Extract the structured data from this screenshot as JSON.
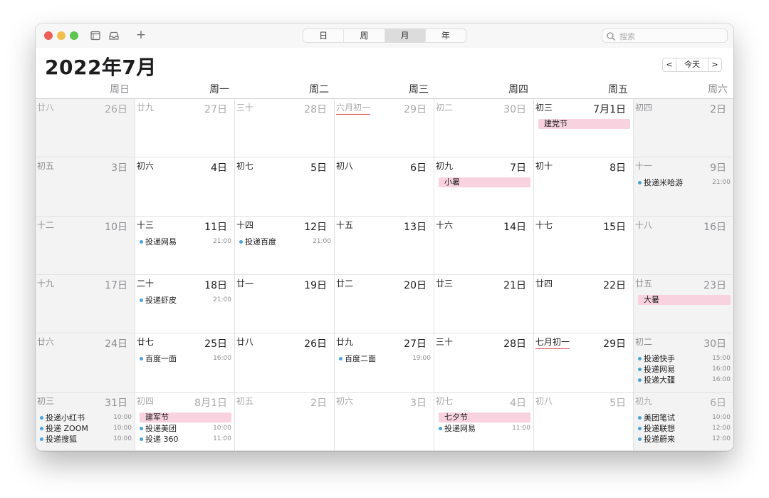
{
  "toolbar": {
    "views": [
      "日",
      "周",
      "月",
      "年"
    ],
    "active_view": "月",
    "search_placeholder": "搜索",
    "add_label": "+"
  },
  "header": {
    "title": "2022年7月",
    "today_label": "今天",
    "prev_label": "<",
    "next_label": ">"
  },
  "weekdays": [
    "周日",
    "周一",
    "周二",
    "周三",
    "周四",
    "周五",
    "周六"
  ],
  "colors": {
    "close": "#ec5f57",
    "minimize": "#f4be4f",
    "zoom": "#5ec64d",
    "allday_event": "#f8d3df",
    "event_dot": "#4aa3df",
    "lunar_underline": "#e0505a"
  },
  "weeks": [
    [
      {
        "day": "26日",
        "lunar": "廿八",
        "dim": true,
        "events": []
      },
      {
        "day": "27日",
        "lunar": "廿九",
        "dim": true,
        "events": []
      },
      {
        "day": "28日",
        "lunar": "三十",
        "dim": true,
        "events": []
      },
      {
        "day": "29日",
        "lunar": "六月初一",
        "dim": true,
        "underline": true,
        "events": []
      },
      {
        "day": "30日",
        "lunar": "初二",
        "dim": true,
        "events": []
      },
      {
        "day": "7月1日",
        "lunar": "初三",
        "events": [
          {
            "type": "allday",
            "name": "建党节"
          }
        ]
      },
      {
        "day": "2日",
        "lunar": "初四",
        "events": []
      }
    ],
    [
      {
        "day": "3日",
        "lunar": "初五",
        "events": []
      },
      {
        "day": "4日",
        "lunar": "初六",
        "events": []
      },
      {
        "day": "5日",
        "lunar": "初七",
        "events": []
      },
      {
        "day": "6日",
        "lunar": "初八",
        "events": []
      },
      {
        "day": "7日",
        "lunar": "初九",
        "events": [
          {
            "type": "allday",
            "name": "小暑"
          }
        ]
      },
      {
        "day": "8日",
        "lunar": "初十",
        "events": []
      },
      {
        "day": "9日",
        "lunar": "十一",
        "events": [
          {
            "type": "timed",
            "name": "投递米哈游",
            "time": "21:00"
          }
        ]
      }
    ],
    [
      {
        "day": "10日",
        "lunar": "十二",
        "events": []
      },
      {
        "day": "11日",
        "lunar": "十三",
        "events": [
          {
            "type": "timed",
            "name": "投递网易",
            "time": "21:00"
          }
        ]
      },
      {
        "day": "12日",
        "lunar": "十四",
        "events": [
          {
            "type": "timed",
            "name": "投递百度",
            "time": "21:00"
          }
        ]
      },
      {
        "day": "13日",
        "lunar": "十五",
        "events": []
      },
      {
        "day": "14日",
        "lunar": "十六",
        "events": []
      },
      {
        "day": "15日",
        "lunar": "十七",
        "events": []
      },
      {
        "day": "16日",
        "lunar": "十八",
        "events": []
      }
    ],
    [
      {
        "day": "17日",
        "lunar": "十九",
        "events": []
      },
      {
        "day": "18日",
        "lunar": "二十",
        "events": [
          {
            "type": "timed",
            "name": "投递虾皮",
            "time": "21:00"
          }
        ]
      },
      {
        "day": "19日",
        "lunar": "廿一",
        "events": []
      },
      {
        "day": "20日",
        "lunar": "廿二",
        "events": []
      },
      {
        "day": "21日",
        "lunar": "廿三",
        "events": []
      },
      {
        "day": "22日",
        "lunar": "廿四",
        "events": []
      },
      {
        "day": "23日",
        "lunar": "廿五",
        "events": [
          {
            "type": "allday",
            "name": "大暑"
          }
        ]
      }
    ],
    [
      {
        "day": "24日",
        "lunar": "廿六",
        "events": []
      },
      {
        "day": "25日",
        "lunar": "廿七",
        "events": [
          {
            "type": "timed",
            "name": "百度一面",
            "time": "16:00"
          }
        ]
      },
      {
        "day": "26日",
        "lunar": "廿八",
        "events": []
      },
      {
        "day": "27日",
        "lunar": "廿九",
        "events": [
          {
            "type": "timed",
            "name": "百度二面",
            "time": "19:00"
          }
        ]
      },
      {
        "day": "28日",
        "lunar": "三十",
        "events": []
      },
      {
        "day": "29日",
        "lunar": "七月初一",
        "underline": true,
        "events": []
      },
      {
        "day": "30日",
        "lunar": "初二",
        "events": [
          {
            "type": "timed",
            "name": "投递快手",
            "time": "15:00"
          },
          {
            "type": "timed",
            "name": "投递网易",
            "time": "16:00"
          },
          {
            "type": "timed",
            "name": "投递大疆",
            "time": "16:00"
          }
        ]
      }
    ],
    [
      {
        "day": "31日",
        "lunar": "初三",
        "events": [
          {
            "type": "timed",
            "name": "投递小红书",
            "time": "10:00"
          },
          {
            "type": "timed",
            "name": "投递 ZOOM",
            "time": "10:00"
          },
          {
            "type": "timed",
            "name": "投递搜狐",
            "time": "10:00"
          }
        ]
      },
      {
        "day": "8月1日",
        "lunar": "初四",
        "dim": true,
        "events": [
          {
            "type": "allday",
            "name": "建军节"
          },
          {
            "type": "timed",
            "name": "投递美团",
            "time": "10:00"
          },
          {
            "type": "timed",
            "name": "投递 360",
            "time": "11:00"
          }
        ]
      },
      {
        "day": "2日",
        "lunar": "初五",
        "dim": true,
        "events": []
      },
      {
        "day": "3日",
        "lunar": "初六",
        "dim": true,
        "events": []
      },
      {
        "day": "4日",
        "lunar": "初七",
        "dim": true,
        "events": [
          {
            "type": "allday",
            "name": "七夕节"
          },
          {
            "type": "timed",
            "name": "投递网易",
            "time": "11:00"
          }
        ]
      },
      {
        "day": "5日",
        "lunar": "初八",
        "dim": true,
        "events": []
      },
      {
        "day": "6日",
        "lunar": "初九",
        "dim": true,
        "events": [
          {
            "type": "timed",
            "name": "美团笔试",
            "time": "10:00"
          },
          {
            "type": "timed",
            "name": "投递联想",
            "time": "12:00"
          },
          {
            "type": "timed",
            "name": "投递蔚来",
            "time": "12:00"
          }
        ]
      }
    ]
  ]
}
